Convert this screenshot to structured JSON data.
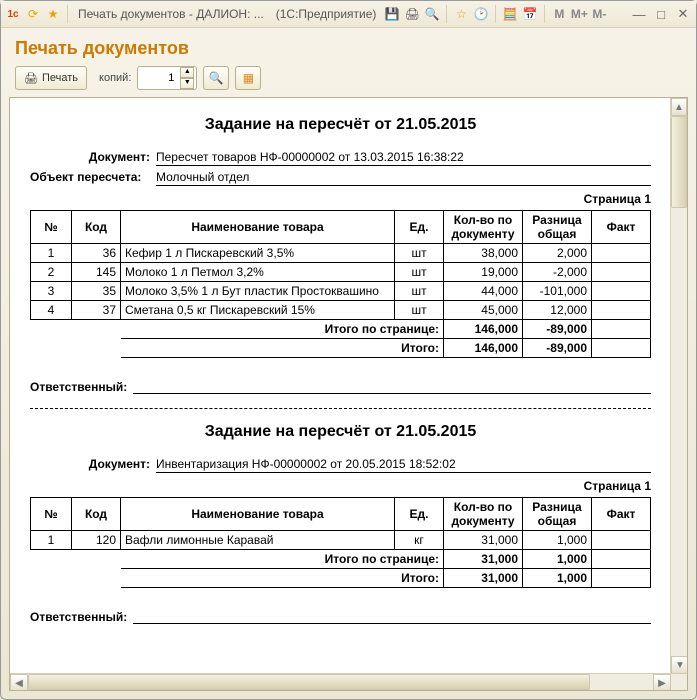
{
  "titlebar": {
    "app_title": "Печать документов - ДАЛИОН: ...",
    "context": "(1С:Предприятие)",
    "m_labels": [
      "M",
      "M+",
      "M-"
    ]
  },
  "page_title": "Печать документов",
  "toolbar": {
    "print_label": "Печать",
    "copies_label": "копий:",
    "copies_value": "1"
  },
  "reports": [
    {
      "title": "Задание на пересчёт от 21.05.2015",
      "doc_label": "Документ:",
      "doc_value": "Пересчет товаров НФ-00000002 от 13.03.2015 16:38:22",
      "obj_label": "Объект пересчета:",
      "obj_value": "Молочный отдел",
      "page_num": "Страница 1",
      "headers": {
        "n": "№",
        "code": "Код",
        "name": "Наименование товара",
        "unit": "Ед.",
        "qty": "Кол-во по документу",
        "diff": "Разница общая",
        "fact": "Факт"
      },
      "rows": [
        {
          "n": "1",
          "code": "36",
          "name": "Кефир 1 л  Пискаревский 3,5%",
          "unit": "шт",
          "qty": "38,000",
          "diff": "2,000",
          "fact": ""
        },
        {
          "n": "2",
          "code": "145",
          "name": "Молоко 1 л  Петмол 3,2%",
          "unit": "шт",
          "qty": "19,000",
          "diff": "-2,000",
          "fact": ""
        },
        {
          "n": "3",
          "code": "35",
          "name": "Молоко 3,5% 1 л Бут пластик Простоквашино",
          "unit": "шт",
          "qty": "44,000",
          "diff": "-101,000",
          "fact": ""
        },
        {
          "n": "4",
          "code": "37",
          "name": "Сметана 0,5 кг  Пискаревский 15%",
          "unit": "шт",
          "qty": "45,000",
          "diff": "12,000",
          "fact": ""
        }
      ],
      "page_total_label": "Итого по странице:",
      "page_total_qty": "146,000",
      "page_total_diff": "-89,000",
      "total_label": "Итого:",
      "total_qty": "146,000",
      "total_diff": "-89,000",
      "responsible_label": "Ответственный:"
    },
    {
      "title": "Задание на пересчёт от 21.05.2015",
      "doc_label": "Документ:",
      "doc_value": "Инвентаризация НФ-00000002 от 20.05.2015 18:52:02",
      "obj_label": "",
      "obj_value": "",
      "page_num": "Страница 1",
      "headers": {
        "n": "№",
        "code": "Код",
        "name": "Наименование товара",
        "unit": "Ед.",
        "qty": "Кол-во по документу",
        "diff": "Разница общая",
        "fact": "Факт"
      },
      "rows": [
        {
          "n": "1",
          "code": "120",
          "name": "Вафли лимонные Каравай",
          "unit": "кг",
          "qty": "31,000",
          "diff": "1,000",
          "fact": ""
        }
      ],
      "page_total_label": "Итого по странице:",
      "page_total_qty": "31,000",
      "page_total_diff": "1,000",
      "total_label": "Итого:",
      "total_qty": "31,000",
      "total_diff": "1,000",
      "responsible_label": "Ответственный:"
    }
  ]
}
